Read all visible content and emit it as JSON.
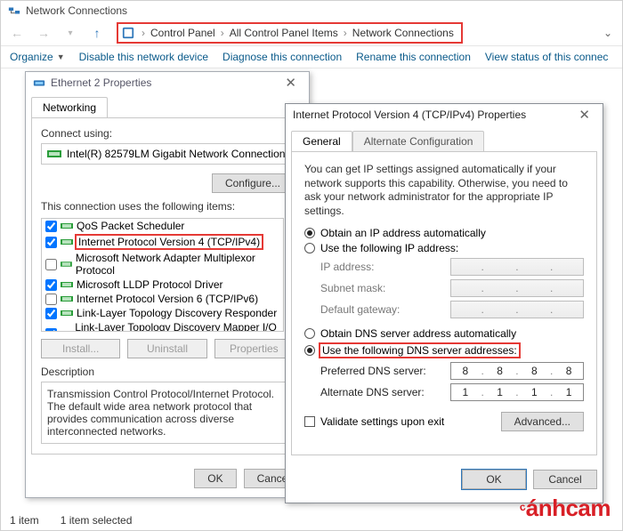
{
  "explorer": {
    "title": "Network Connections",
    "breadcrumbs": [
      "Control Panel",
      "All Control Panel Items",
      "Network Connections"
    ],
    "commands": {
      "organize": "Organize",
      "disable": "Disable this network device",
      "diagnose": "Diagnose this connection",
      "rename": "Rename this connection",
      "viewstatus": "View status of this connec"
    },
    "status_left": "1 item",
    "status_right": "1 item selected"
  },
  "eth_dialog": {
    "title": "Ethernet 2 Properties",
    "tab_networking": "Networking",
    "connect_using": "Connect using:",
    "adapter": "Intel(R) 82579LM Gigabit Network Connection",
    "configure": "Configure...",
    "items_label": "This connection uses the following items:",
    "items": [
      {
        "checked": true,
        "label": "QoS Packet Scheduler"
      },
      {
        "checked": true,
        "label": "Internet Protocol Version 4 (TCP/IPv4)",
        "highlight": true
      },
      {
        "checked": false,
        "label": "Microsoft Network Adapter Multiplexor Protocol"
      },
      {
        "checked": true,
        "label": "Microsoft LLDP Protocol Driver"
      },
      {
        "checked": false,
        "label": "Internet Protocol Version 6 (TCP/IPv6)"
      },
      {
        "checked": true,
        "label": "Link-Layer Topology Discovery Responder"
      },
      {
        "checked": true,
        "label": "Link-Layer Topology Discovery Mapper I/O Driver"
      }
    ],
    "install": "Install...",
    "uninstall": "Uninstall",
    "properties": "Properties",
    "description_label": "Description",
    "description": "Transmission Control Protocol/Internet Protocol. The default wide area network protocol that provides communication across diverse interconnected networks.",
    "ok": "OK",
    "cancel": "Cancel"
  },
  "ipv4_dialog": {
    "title": "Internet Protocol Version 4 (TCP/IPv4) Properties",
    "tab_general": "General",
    "tab_alt": "Alternate Configuration",
    "info": "You can get IP settings assigned automatically if your network supports this capability. Otherwise, you need to ask your network administrator for the appropriate IP settings.",
    "r_obtain_ip": "Obtain an IP address automatically",
    "r_use_ip": "Use the following IP address:",
    "ip_label": "IP address:",
    "mask_label": "Subnet mask:",
    "gw_label": "Default gateway:",
    "r_obtain_dns": "Obtain DNS server address automatically",
    "r_use_dns": "Use the following DNS server addresses:",
    "pref_dns_label": "Preferred DNS server:",
    "alt_dns_label": "Alternate DNS server:",
    "pref_dns_segments": [
      "8",
      "8",
      "8",
      "8"
    ],
    "alt_dns_segments": [
      "1",
      "1",
      "1",
      "1"
    ],
    "validate": "Validate settings upon exit",
    "advanced": "Advanced...",
    "ok": "OK",
    "cancel": "Cancel"
  },
  "watermark": "cánhcam"
}
